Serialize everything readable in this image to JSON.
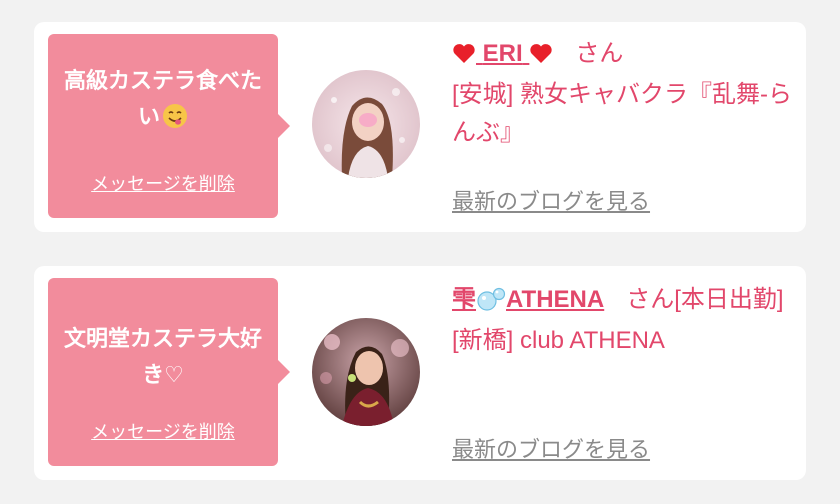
{
  "colors": {
    "accent": "#e2476b",
    "bubble": "#f28c9c",
    "muted_link": "#8a8a8a",
    "background": "#f2f2f2"
  },
  "cards": [
    {
      "message": "高級カステラ食べたい",
      "message_emoji": "yum-face-emoji",
      "delete_label": "メッセージを削除",
      "name": "ERI",
      "name_decoration": "red-heart-emoji",
      "honorific": "さん",
      "shop": "[安城] 熟女キャバクラ『乱舞-らんぶ』",
      "blog_label": "最新のブログを見る",
      "avatar": "cast-photo-eri"
    },
    {
      "message": "文明堂カステラ大好き♡",
      "delete_label": "メッセージを削除",
      "name_prefix": "雫",
      "name_prefix_emoji": "bubbles-emoji",
      "name": "ATHENA",
      "honorific": "さん[本日出勤]",
      "shop": "[新橋] club ATHENA",
      "blog_label": "最新のブログを見る",
      "avatar": "cast-photo-athena"
    }
  ]
}
